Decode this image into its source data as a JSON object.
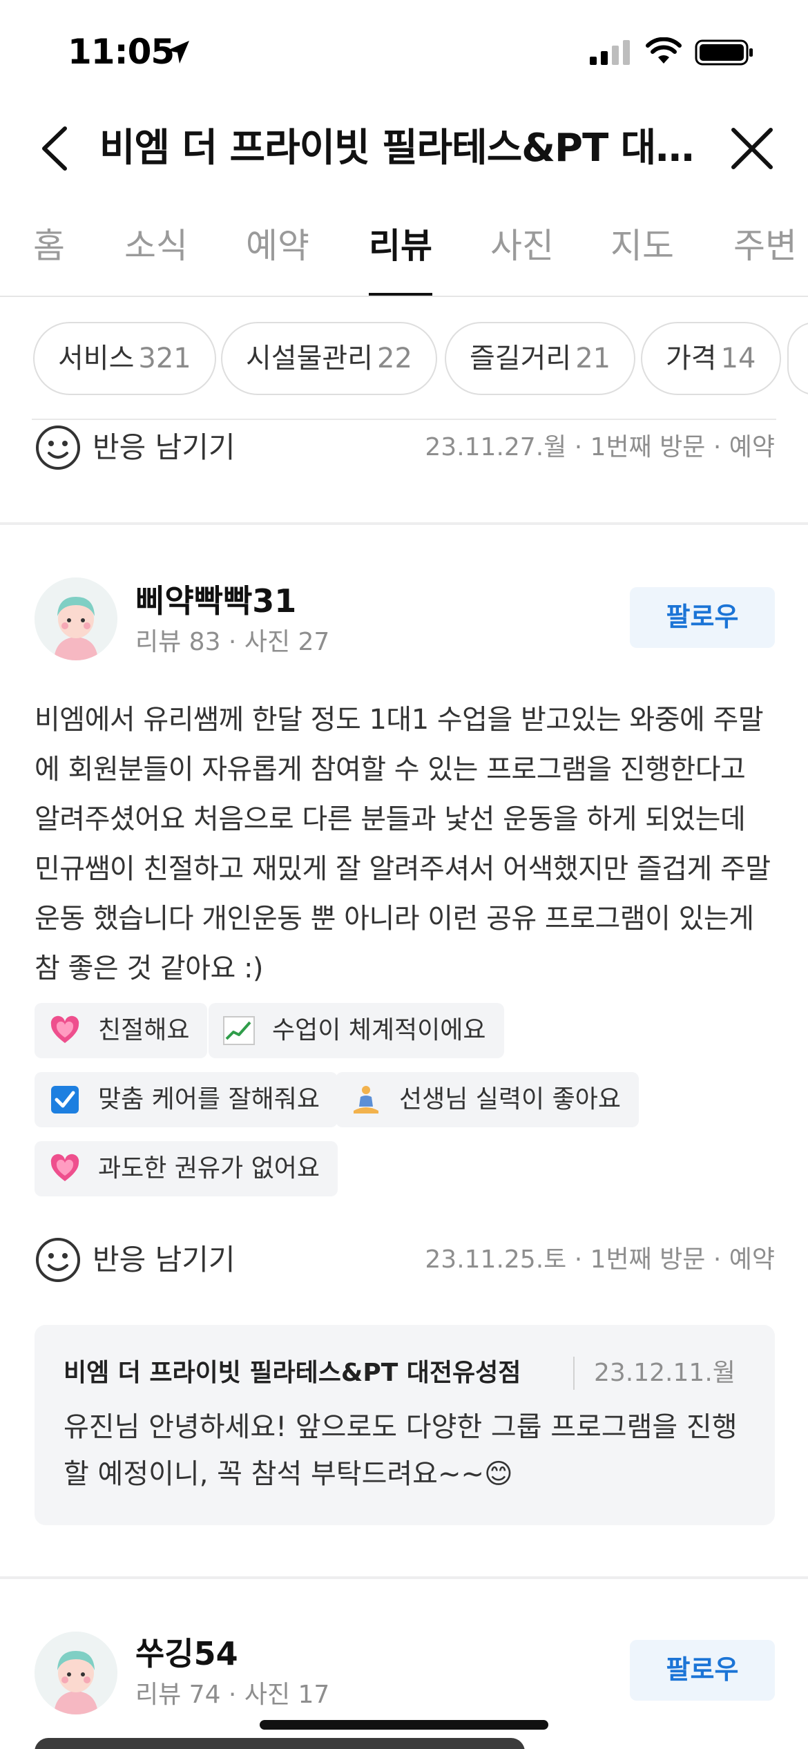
{
  "status_bar": {
    "time": "11:05"
  },
  "header": {
    "title": "비엠 더 프라이빗 필라테스&PT 대전..."
  },
  "tabs": [
    {
      "label": "홈"
    },
    {
      "label": "소식"
    },
    {
      "label": "예약"
    },
    {
      "label": "리뷰",
      "active": true
    },
    {
      "label": "사진"
    },
    {
      "label": "지도"
    },
    {
      "label": "주변"
    }
  ],
  "filters": [
    {
      "label": "서비스",
      "count": "321"
    },
    {
      "label": "시설물관리",
      "count": "22"
    },
    {
      "label": "즐길거리",
      "count": "21"
    },
    {
      "label": "가격",
      "count": "14"
    }
  ],
  "prev_review": {
    "react_label": "반응 남기기",
    "meta": "23.11.27.월 · 1번째 방문 · 예약"
  },
  "review": {
    "name": "삐약빡빡31",
    "meta": "리뷰 83 · 사진 27",
    "follow_label": "팔로우",
    "text": "비엠에서 유리쌤께 한달 정도 1대1 수업을 받고있는 와중에 주말에 회원분들이 자유롭게 참여할 수 있는 프로그램을 진행한다고 알려주셨어요 처음으로 다른 분들과 낯선 운동을 하게 되었는데 민규쌤이 친절하고 재밌게 잘 알려주셔서 어색했지만 즐겁게 주말운동 했습니다 개인운동 뿐 아니라 이런 공유 프로그램이 있는게 참 좋은 것 같아요 :)",
    "keywords": [
      {
        "icon": "heart-icon",
        "label": "친절해요"
      },
      {
        "icon": "chart-up-icon",
        "label": "수업이 체계적이에요"
      },
      {
        "icon": "check-box-icon",
        "label": "맞춤 케어를 잘해줘요"
      },
      {
        "icon": "meditation-icon",
        "label": "선생님 실력이 좋아요"
      },
      {
        "icon": "heart-icon",
        "label": "과도한 권유가 없어요"
      }
    ],
    "react_label": "반응 남기기",
    "visit_meta": "23.11.25.토 · 1번째 방문 · 예약",
    "reply": {
      "owner": "비엠 더 프라이빗 필라테스&PT 대전유성점",
      "date": "23.12.11.월",
      "text": "유진님 안녕하세요! 앞으로도 다양한 그룹 프로그램을 진행할 예정이니, 꼭 참석 부탁드려요~~😊"
    }
  },
  "next_review": {
    "name": "쑤깅54",
    "meta": "리뷰 74 · 사진 17",
    "follow_label": "팔로우"
  },
  "colors": {
    "accent": "#1b74d6",
    "follow_bg": "#eef5fc",
    "muted_text": "#8e8e8e",
    "chip_bg": "#f3f4f6"
  }
}
